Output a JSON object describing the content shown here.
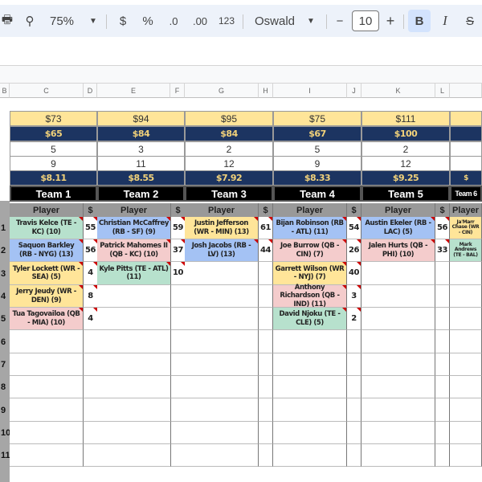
{
  "toolbar": {
    "zoom": "75%",
    "currency": "$",
    "percent": "%",
    "dec_decrease": ".0",
    "dec_increase": ".00",
    "number_format": "123",
    "font": "Oswald",
    "font_size": "10",
    "minus": "−",
    "plus": "+",
    "bold": "B",
    "italic": "I",
    "strike": "S"
  },
  "columns": [
    "B",
    "C",
    "D",
    "E",
    "F",
    "G",
    "H",
    "I",
    "J",
    "K",
    "L",
    ""
  ],
  "summary": {
    "row1": [
      "$73",
      "$94",
      "$95",
      "$75",
      "$111",
      ""
    ],
    "row2": [
      "$65",
      "$84",
      "$84",
      "$67",
      "$100",
      ""
    ],
    "row3": [
      "5",
      "3",
      "2",
      "5",
      "2",
      ""
    ],
    "row4": [
      "9",
      "11",
      "12",
      "9",
      "12",
      ""
    ],
    "row5": [
      "$8.11",
      "$8.55",
      "$7.92",
      "$8.33",
      "$9.25",
      "$"
    ],
    "teams": [
      "Team 1",
      "Team 2",
      "Team 3",
      "Team 4",
      "Team 5",
      "Team 6"
    ]
  },
  "headers": {
    "player": "Player",
    "price": "$"
  },
  "row_numbers": [
    "1",
    "2",
    "3",
    "4",
    "5",
    "6",
    "7",
    "8",
    "9",
    "10",
    "11"
  ],
  "position_colors": {
    "TE": "#b7e1cd",
    "RB": "#a4c2f4",
    "WR": "#ffe599",
    "QB": "#f4cccc"
  },
  "rosters": [
    [
      {
        "name": "Travis Kelce (TE - KC) (10)",
        "pos": "TE",
        "price": "55"
      },
      {
        "name": "Saquon Barkley (RB - NYG) (13)",
        "pos": "RB",
        "price": "56"
      },
      {
        "name": "Tyler Lockett (WR - SEA) (5)",
        "pos": "WR",
        "price": "4"
      },
      {
        "name": "Jerry Jeudy (WR - DEN) (9)",
        "pos": "WR",
        "price": "8"
      },
      {
        "name": "Tua Tagovailoa (QB - MIA) (10)",
        "pos": "QB",
        "price": "4"
      }
    ],
    [
      {
        "name": "Christian McCaffrey (RB - SF) (9)",
        "pos": "RB",
        "price": "59"
      },
      {
        "name": "Patrick Mahomes II (QB - KC) (10)",
        "pos": "QB",
        "price": "37"
      },
      {
        "name": "Kyle Pitts (TE - ATL) (11)",
        "pos": "TE",
        "price": "10"
      }
    ],
    [
      {
        "name": "Justin Jefferson (WR - MIN) (13)",
        "pos": "WR",
        "price": "61"
      },
      {
        "name": "Josh Jacobs (RB - LV) (13)",
        "pos": "RB",
        "price": "44"
      }
    ],
    [
      {
        "name": "Bijan Robinson (RB - ATL) (11)",
        "pos": "RB",
        "price": "54"
      },
      {
        "name": "Joe Burrow (QB - CIN) (7)",
        "pos": "QB",
        "price": "26"
      },
      {
        "name": "Garrett Wilson (WR - NYJ) (7)",
        "pos": "WR",
        "price": "40"
      },
      {
        "name": "Anthony Richardson (QB - IND) (11)",
        "pos": "QB",
        "price": "3"
      },
      {
        "name": "David Njoku (TE - CLE) (5)",
        "pos": "TE",
        "price": "2"
      }
    ],
    [
      {
        "name": "Austin Ekeler (RB - LAC) (5)",
        "pos": "RB",
        "price": "56"
      },
      {
        "name": "Jalen Hurts (QB - PHI) (10)",
        "pos": "QB",
        "price": "33"
      }
    ],
    [
      {
        "name": "Ja'Marr Chase (WR - CIN)",
        "pos": "WR",
        "price": ""
      },
      {
        "name": "Mark Andrews (TE - BAL)",
        "pos": "TE",
        "price": ""
      }
    ]
  ]
}
